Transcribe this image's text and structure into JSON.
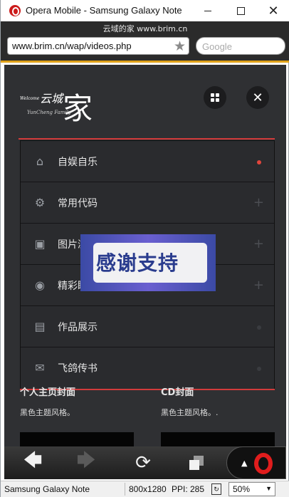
{
  "window": {
    "title": "Opera Mobile - Samsung Galaxy Note",
    "minimize_icon": "minimize-icon",
    "maximize_icon": "maximize-icon",
    "close_glyph": "✕"
  },
  "browser": {
    "page_heading": "云域的家 www.brim.cn",
    "url": "www.brim.cn/wap/videos.php",
    "search_placeholder": "Google",
    "accent_color": "#e0a21a"
  },
  "site": {
    "logo": {
      "welcome": "Welcome",
      "name": "云城",
      "char": "家",
      "sub": "YunCheng Family"
    },
    "grid_icon": "grid-icon",
    "close_glyph": "✕",
    "menu": [
      {
        "label": "自娱自乐",
        "icon_glyph": "⌂",
        "icon": "home-icon",
        "marker": "dot"
      },
      {
        "label": "常用代码",
        "icon_glyph": "⚙",
        "icon": "gear-icon",
        "marker": "+"
      },
      {
        "label": "图片浏览",
        "icon_glyph": "▣",
        "icon": "image-icon",
        "marker": "+"
      },
      {
        "label": "精彩瞬间",
        "icon_glyph": "◉",
        "icon": "camera-icon",
        "marker": "+"
      },
      {
        "label": "作品展示",
        "icon_glyph": "▤",
        "icon": "film-icon",
        "marker": "dim"
      },
      {
        "label": "飞鸽传书",
        "icon_glyph": "✉",
        "icon": "mail-icon",
        "marker": "dim"
      }
    ],
    "banner_text": "感谢支持",
    "cards": [
      {
        "title": "个人主页封面",
        "desc": "黑色主题风格。"
      },
      {
        "title": "CD封面",
        "desc": "黑色主题风格。."
      }
    ]
  },
  "navbar": {
    "back_glyph": "🡄",
    "forward_glyph": "🡆",
    "reload_glyph": "⟳",
    "up_glyph": "▲"
  },
  "status": {
    "device": "Samsung Galaxy Note",
    "resolution": "800x1280",
    "ppi": "PPI: 285",
    "zoom": "50%",
    "zoom_arrow": "▼"
  }
}
